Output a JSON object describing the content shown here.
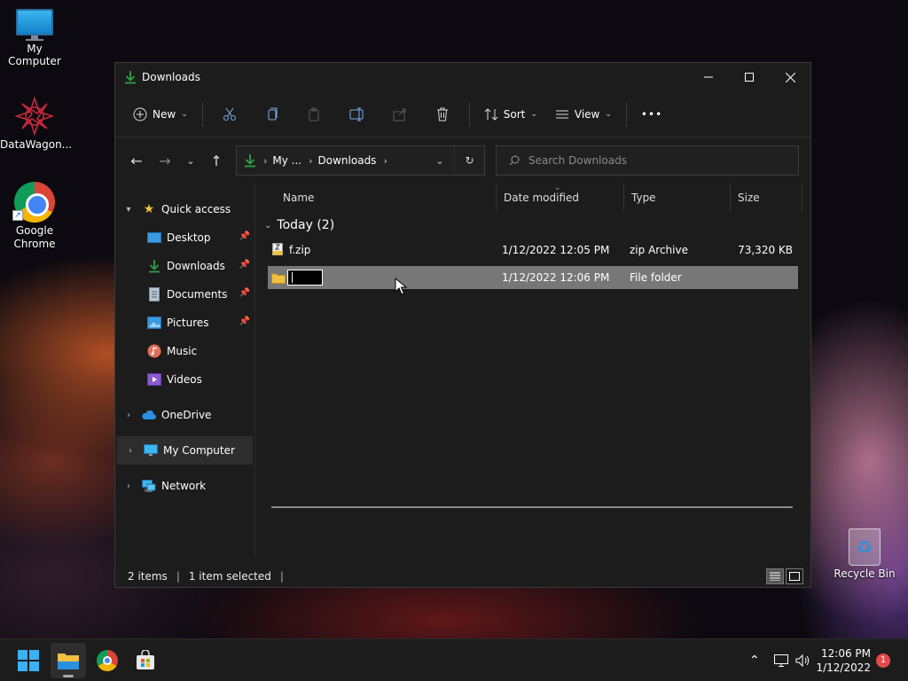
{
  "desktop": {
    "icons": [
      {
        "label": "My Computer"
      },
      {
        "label": "DataWagon..."
      },
      {
        "label": "Google Chrome"
      }
    ],
    "recycle_bin": "Recycle Bin"
  },
  "window": {
    "title": "Downloads",
    "toolbar": {
      "new_label": "New",
      "sort_label": "Sort",
      "view_label": "View",
      "more_label": "•••"
    },
    "address": {
      "crumbs": [
        "My ...",
        "Downloads"
      ]
    },
    "search": {
      "placeholder": "Search Downloads"
    },
    "nav": {
      "quick_access": "Quick access",
      "items": [
        {
          "label": "Desktop",
          "pinned": true
        },
        {
          "label": "Downloads",
          "pinned": true
        },
        {
          "label": "Documents",
          "pinned": true
        },
        {
          "label": "Pictures",
          "pinned": true
        },
        {
          "label": "Music",
          "pinned": false
        },
        {
          "label": "Videos",
          "pinned": false
        }
      ],
      "onedrive": "OneDrive",
      "my_computer": "My Computer",
      "network": "Network"
    },
    "columns": {
      "name": "Name",
      "date": "Date modified",
      "type": "Type",
      "size": "Size"
    },
    "group": "Today (2)",
    "files": [
      {
        "name": "f.zip",
        "date": "1/12/2022 12:05 PM",
        "type": "zip Archive",
        "size": "73,320 KB"
      },
      {
        "name": "",
        "date": "1/12/2022 12:06 PM",
        "type": "File folder",
        "size": ""
      }
    ],
    "status": {
      "count": "2 items",
      "selected": "1 item selected"
    }
  },
  "taskbar": {
    "time": "12:06 PM",
    "date": "1/12/2022",
    "notifications": "1"
  },
  "colors": {
    "accent": "#2ea043",
    "folder": "#f0c040",
    "selected_row": "#777777"
  }
}
